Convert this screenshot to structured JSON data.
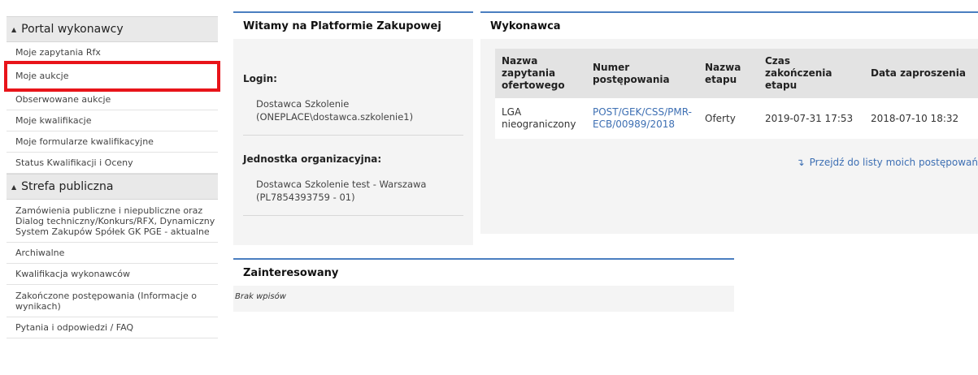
{
  "sidebar": {
    "sections": [
      {
        "title": "Portal wykonawcy",
        "items": [
          "Moje zapytania Rfx",
          "Moje aukcje",
          "Obserwowane aukcje",
          "Moje kwalifikacje",
          "Moje formularze kwalifikacyjne",
          "Status Kwalifikacji i Oceny"
        ]
      },
      {
        "title": "Strefa publiczna",
        "items": [
          "Zamówienia publiczne i niepubliczne oraz Dialog techniczny/Konkurs/RFX, Dynamiczny System Zakupów Spółek GK PGE - aktualne",
          "Archiwalne",
          "Kwalifikacja wykonawców",
          "Zakończone postępowania (Informacje o wynikach)",
          "Pytania i odpowiedzi / FAQ"
        ]
      }
    ],
    "highlighted_item": "Moje aukcje",
    "highlight_color": "#e8141a"
  },
  "welcome": {
    "title": "Witamy na Platformie Zakupowej",
    "login_label": "Login:",
    "login_value": "Dostawca Szkolenie (ONEPLACE\\dostawca.szkolenie1)",
    "unit_label": "Jednostka organizacyjna:",
    "unit_value": "Dostawca Szkolenie test - Warszawa (PL7854393759 - 01)"
  },
  "vendor": {
    "title": "Wykonawca",
    "columns": [
      "Nazwa zapytania ofertowego",
      "Numer postępowania",
      "Nazwa etapu",
      "Czas zakończenia etapu",
      "Data zaproszenia"
    ],
    "rows": [
      {
        "name": "LGA nieograniczony",
        "number": "POST/GEK/CSS/PMR-ECB/00989/2018",
        "stage": "Oferty",
        "stage_end": "2019-07-31 17:53",
        "invited": "2018-07-10 18:32"
      }
    ],
    "list_link": "Przejdź do listy moich postępowań",
    "link_color": "#3d6fb3"
  },
  "interested": {
    "title": "Zainteresowany",
    "empty_text": "Brak wpisów"
  },
  "accent_color": "#4a7ec0"
}
